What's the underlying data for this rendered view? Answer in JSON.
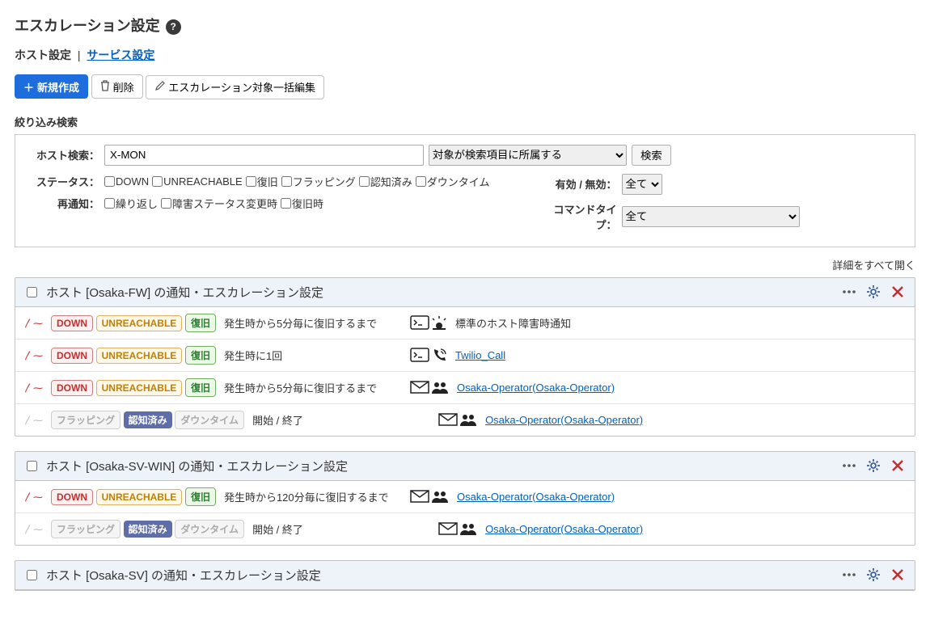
{
  "pageTitle": "エスカレーション設定",
  "tabs": {
    "host": "ホスト設定",
    "sep": "|",
    "service": "サービス設定"
  },
  "buttons": {
    "create": "新規作成",
    "delete": "削除",
    "bulkEdit": "エスカレーション対象一括編集"
  },
  "filter": {
    "title": "絞り込み検索",
    "hostLabel": "ホスト検索：",
    "hostValue": "X-MON",
    "scopeOptions": [
      "対象が検索項目に所属する"
    ],
    "scopeSelected": "対象が検索項目に所属する",
    "searchBtn": "検索",
    "statusLabel": "ステータス：",
    "statusChecks": [
      "DOWN",
      "UNREACHABLE",
      "復旧",
      "フラッピング",
      "認知済み",
      "ダウンタイム"
    ],
    "enabledLabel": "有効 / 無効：",
    "enabledOptions": [
      "全て"
    ],
    "enabledSelected": "全て",
    "renoticeLabel": "再通知：",
    "renoticeChecks": [
      "繰り返し",
      "障害ステータス変更時",
      "復旧時"
    ],
    "cmdTypeLabel": "コマンドタイプ：",
    "cmdTypeOptions": [
      "全て"
    ],
    "cmdTypeSelected": "全て"
  },
  "expandAll": "詳細をすべて開く",
  "badgeLabels": {
    "down": "DOWN",
    "unreach": "UNREACHABLE",
    "restore": "復旧",
    "flap": "フラッピング",
    "ack": "認知済み",
    "dt": "ダウンタイム"
  },
  "panels": [
    {
      "title": "ホスト [Osaka-FW] の通知・エスカレーション設定",
      "rows": [
        {
          "hbActive": true,
          "badges": [
            "down",
            "unreach",
            "restore"
          ],
          "timing": "発生時から5分毎に復旧するまで",
          "method": "terminal-alarm",
          "target": "標準のホスト障害時通知",
          "link": false
        },
        {
          "hbActive": true,
          "badges": [
            "down",
            "unreach",
            "restore"
          ],
          "timing": "発生時に1回",
          "method": "terminal-phone",
          "target": "Twilio_Call",
          "link": true
        },
        {
          "hbActive": true,
          "badges": [
            "down",
            "unreach",
            "restore"
          ],
          "timing": "発生時から5分毎に復旧するまで",
          "method": "mail-group",
          "target": "Osaka-Operator(Osaka-Operator)",
          "link": true
        },
        {
          "hbActive": false,
          "badges": [
            "flap",
            "ack",
            "dt"
          ],
          "timing": "開始 / 終了",
          "method": "mail-group",
          "target": "Osaka-Operator(Osaka-Operator)",
          "link": true
        }
      ]
    },
    {
      "title": "ホスト [Osaka-SV-WIN] の通知・エスカレーション設定",
      "rows": [
        {
          "hbActive": true,
          "badges": [
            "down",
            "unreach",
            "restore"
          ],
          "timing": "発生時から120分毎に復旧するまで",
          "method": "mail-group",
          "target": "Osaka-Operator(Osaka-Operator)",
          "link": true
        },
        {
          "hbActive": false,
          "badges": [
            "flap",
            "ack",
            "dt"
          ],
          "timing": "開始 / 終了",
          "method": "mail-group",
          "target": "Osaka-Operator(Osaka-Operator)",
          "link": true
        }
      ]
    },
    {
      "title": "ホスト [Osaka-SV] の通知・エスカレーション設定",
      "rows": []
    }
  ]
}
